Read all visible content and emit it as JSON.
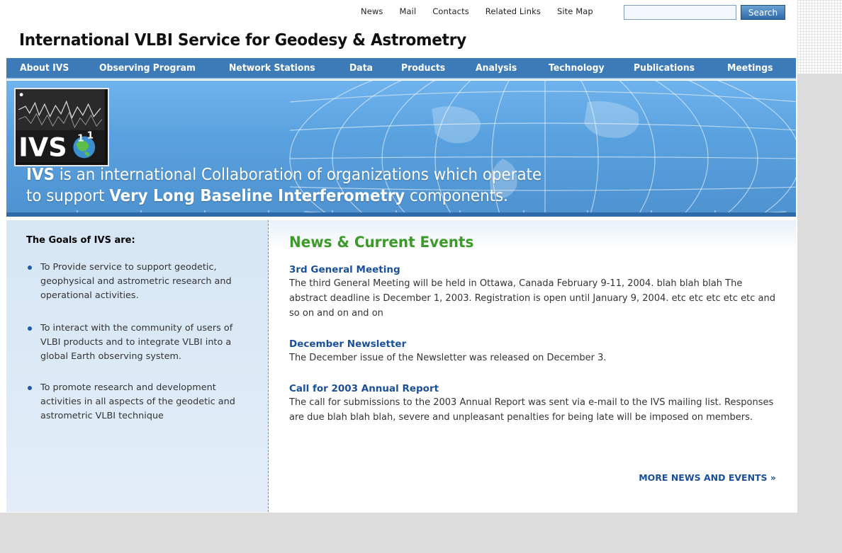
{
  "top_nav": {
    "links": [
      "News",
      "Mail",
      "Contacts",
      "Related Links",
      "Site Map"
    ],
    "search": {
      "value": "",
      "placeholder": "",
      "button_label": "Search"
    }
  },
  "site_title": "International VLBI Service for Geodesy & Astrometry",
  "main_nav": {
    "items": [
      "About IVS",
      "Observing Program",
      "Network Stations",
      "Data",
      "Products",
      "Analysis",
      "Technology",
      "Publications",
      "Meetings"
    ]
  },
  "hero": {
    "line1_bold": "IVS",
    "line1_rest": " is an international Collaboration of organizations which operate",
    "line2_start": "to support ",
    "line2_bold": "Very Long Baseline Interferometry",
    "line2_end": " components.",
    "logo_text": "IVS"
  },
  "goals": {
    "title": "The Goals of IVS are:",
    "items": [
      "To Provide service to support geodetic, geophysical and astrometric research and operational activities.",
      "To interact with the community of users of VLBI products and to integrate VLBI into a global Earth observing system.",
      "To promote research and development activities in all aspects of the geodetic and astrometric VLBI technique"
    ]
  },
  "news": {
    "title": "News & Current Events",
    "items": [
      {
        "heading": "3rd General Meeting",
        "body": "The third General Meeting will be held in Ottawa, Canada February 9-11, 2004. blah blah blah The abstract deadline is December 1, 2003. Registration is open until January 9, 2004. etc etc etc etc etc and so on and on and on"
      },
      {
        "heading": "December Newsletter",
        "body": "The December issue of the Newsletter was released on December 3."
      },
      {
        "heading": "Call for 2003 Annual Report",
        "body": "The call for submissions to the 2003 Annual Report was sent via e-mail to the IVS mailing list. Responses are due blah blah blah, severe and unpleasant penalties for being late will be imposed on members."
      }
    ],
    "more_link": "MORE NEWS AND EVENTS »"
  },
  "colors": {
    "nav_bar": "#3d7bb8",
    "news_title": "#3c9a2a",
    "link_blue": "#1a4f9c",
    "goals_bg": "#d6e6f5",
    "gutter_gray": "#dcdcdc"
  }
}
